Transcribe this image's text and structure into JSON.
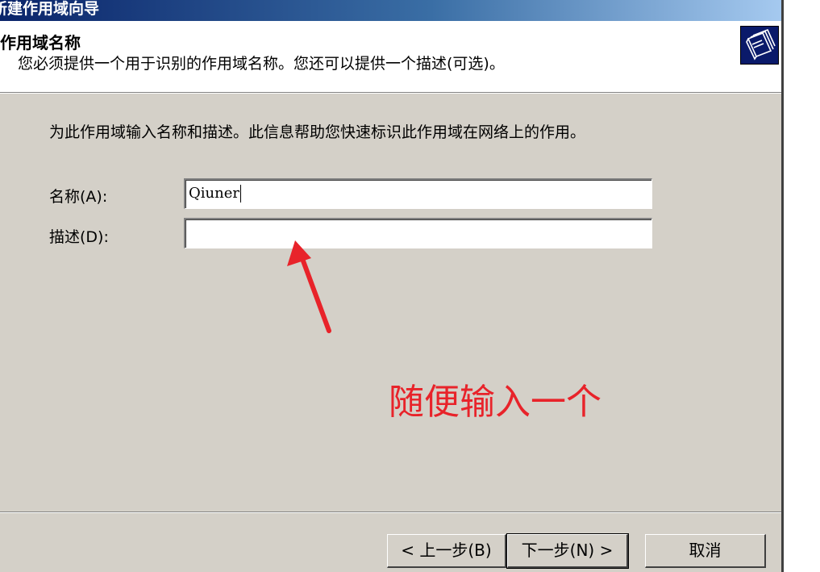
{
  "window": {
    "title": "新建作用域向导"
  },
  "header": {
    "title": "作用域名称",
    "subtitle": "您必须提供一个用于识别的作用域名称。您还可以提供一个描述(可选)。",
    "icon": "scope-folder-icon"
  },
  "main": {
    "instruction": "为此作用域输入名称和描述。此信息帮助您快速标识此作用域在网络上的作用。",
    "name_label": "名称(A):",
    "name_value": "Qiuner",
    "description_label": "描述(D):",
    "description_value": ""
  },
  "annotation": {
    "text": "随便输入一个",
    "color": "#e8232a"
  },
  "buttons": {
    "back": "< 上一步(B)",
    "next": "下一步(N) >",
    "cancel": "取消"
  },
  "colors": {
    "dialog_bg": "#d4d0c8",
    "titlebar_start": "#0a246a",
    "titlebar_end": "#a6caf0"
  }
}
